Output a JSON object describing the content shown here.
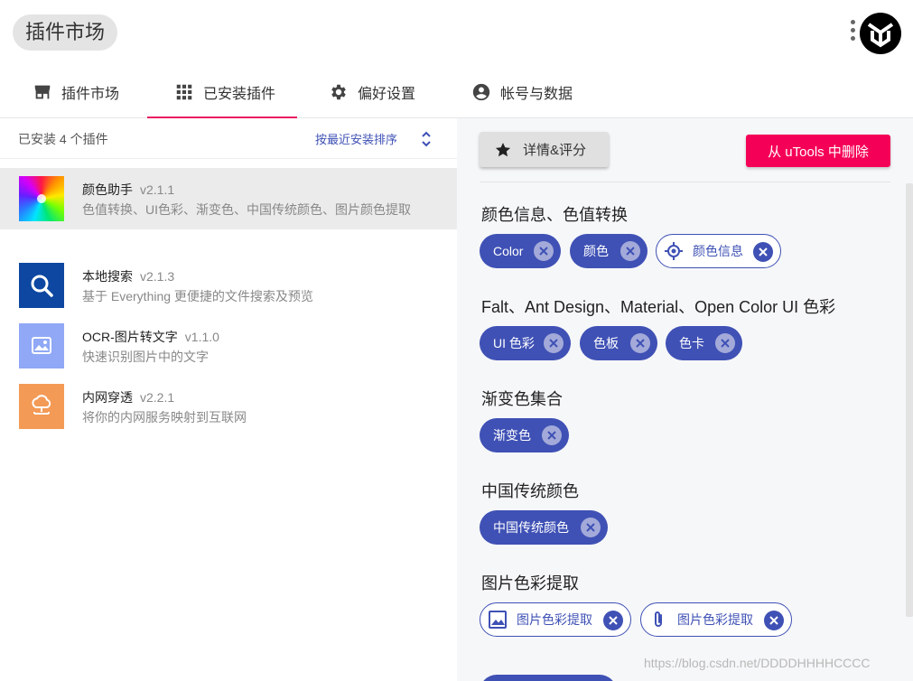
{
  "header": {
    "title": "插件市场"
  },
  "tabs": [
    {
      "label": "插件市场",
      "icon": "store-icon"
    },
    {
      "label": "已安装插件",
      "icon": "grid-icon",
      "active": true
    },
    {
      "label": "偏好设置",
      "icon": "gear-icon"
    },
    {
      "label": "帐号与数据",
      "icon": "account-icon"
    }
  ],
  "list": {
    "count_text": "已安装 4 个插件",
    "sort_label": "按最近安装排序",
    "items": [
      {
        "name": "颜色助手",
        "version": "v2.1.1",
        "desc": "色值转换、UI色彩、渐变色、中国传统颜色、图片颜色提取",
        "icon": "color-wheel-icon",
        "selected": true
      },
      {
        "name": "本地搜索",
        "version": "v2.1.3",
        "desc": "基于 Everything 更便捷的文件搜索及预览",
        "icon": "search-icon",
        "color": "#0d47a1"
      },
      {
        "name": "OCR-图片转文字",
        "version": "v1.1.0",
        "desc": "快速识别图片中的文字",
        "icon": "image-text-icon",
        "color": "#90a8f5"
      },
      {
        "name": "内网穿透",
        "version": "v2.2.1",
        "desc": "将你的内网服务映射到互联网",
        "icon": "cloud-network-icon",
        "color": "#f39a56"
      }
    ]
  },
  "detail": {
    "detail_button": "详情&评分",
    "delete_button": "从 uTools 中删除",
    "sections": [
      {
        "title": "颜色信息、色值转换",
        "chips": [
          "Color",
          "颜色",
          "颜色信息"
        ]
      },
      {
        "title": "Falt、Ant Design、Material、Open Color UI 色彩",
        "chips": [
          "UI 色彩",
          "色板",
          "色卡"
        ]
      },
      {
        "title": "渐变色集合",
        "chips": [
          "渐变色"
        ]
      },
      {
        "title": "中国传统颜色",
        "chips": [
          "中国传统颜色"
        ]
      },
      {
        "title": "图片色彩提取",
        "chips": [
          "图片色彩提取",
          "图片色彩提取"
        ]
      }
    ]
  },
  "watermark": "https://blog.csdn.net/DDDDHHHHCCCC",
  "colors": {
    "accent": "#3f51b5",
    "danger": "#f50057",
    "tab_indicator": "#e91e63"
  }
}
